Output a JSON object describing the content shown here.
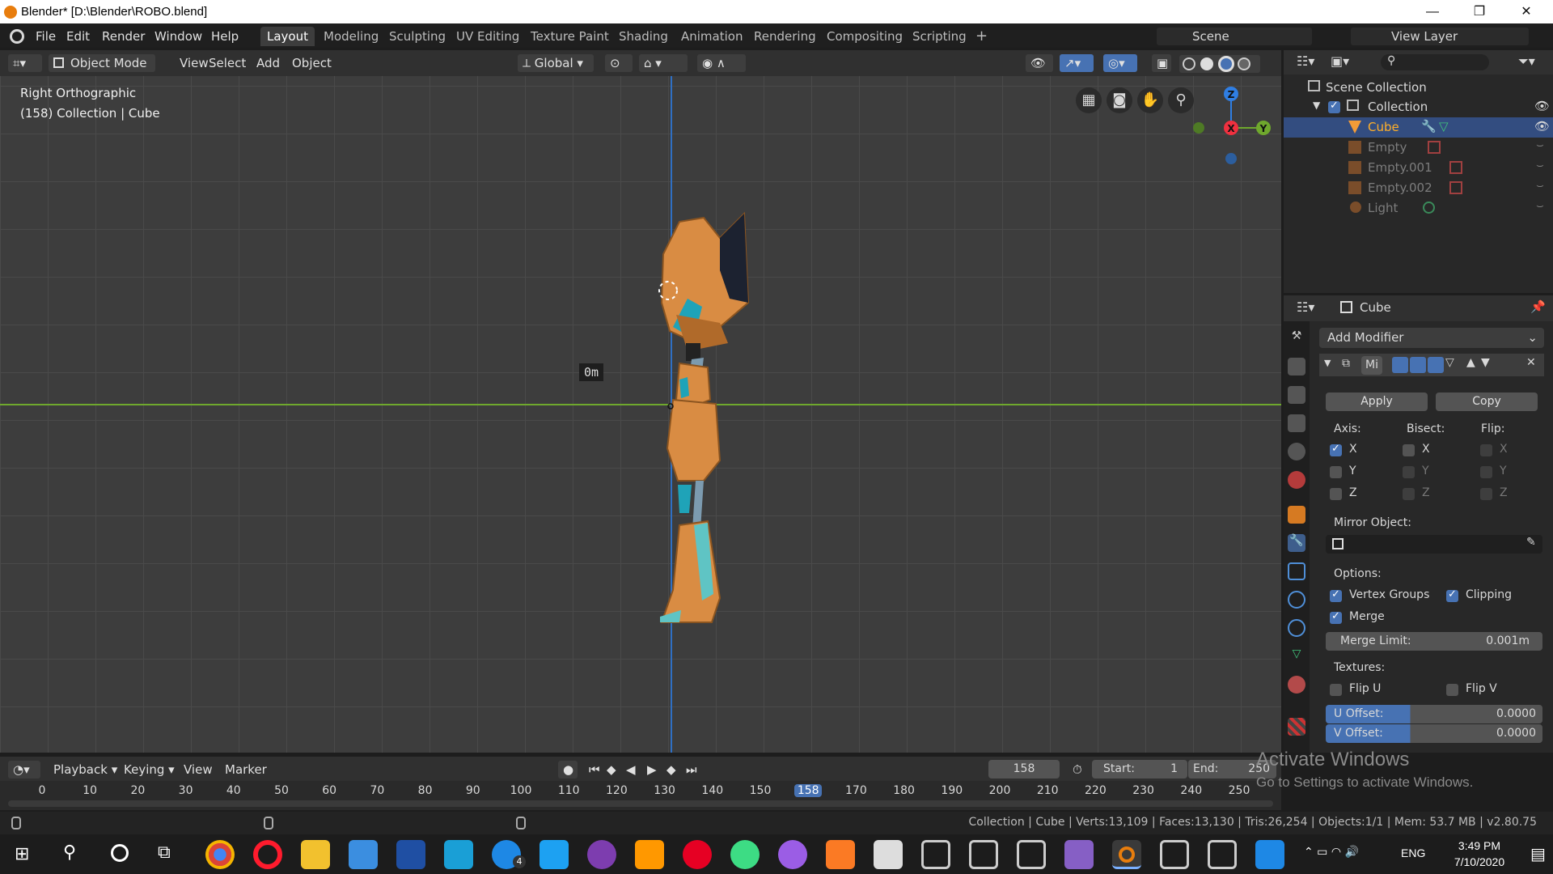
{
  "window": {
    "title": "Blender* [D:\\Blender\\ROBO.blend]"
  },
  "menu": {
    "items": [
      "File",
      "Edit",
      "Render",
      "Window",
      "Help"
    ]
  },
  "workspaces": [
    "Layout",
    "Modeling",
    "Sculpting",
    "UV Editing",
    "Texture Paint",
    "Shading",
    "Animation",
    "Rendering",
    "Compositing",
    "Scripting"
  ],
  "active_workspace": "Layout",
  "scene": {
    "label": "Scene",
    "view_layer": "View Layer"
  },
  "viewport": {
    "mode": "Object Mode",
    "menus": [
      "View",
      "Select",
      "Add",
      "Object"
    ],
    "transform_orientation": "Global",
    "view_name": "Right Orthographic",
    "collection_info": "(158) Collection | Cube",
    "ruler": "0m",
    "gizmo": {
      "z": "Z",
      "x": "X",
      "y": "Y"
    }
  },
  "outliner": {
    "root": "Scene Collection",
    "collection": "Collection",
    "items": [
      "Cube",
      "Empty",
      "Empty.001",
      "Empty.002",
      "Light"
    ]
  },
  "properties": {
    "object": "Cube",
    "add_modifier": "Add Modifier",
    "modifier_name": "Mi",
    "apply": "Apply",
    "copy": "Copy",
    "axis_label": "Axis:",
    "bisect_label": "Bisect:",
    "flip_label": "Flip:",
    "axes": [
      "X",
      "Y",
      "Z"
    ],
    "mirror_object_label": "Mirror Object:",
    "options_label": "Options:",
    "vertex_groups": "Vertex Groups",
    "clipping": "Clipping",
    "merge": "Merge",
    "merge_limit_label": "Merge Limit:",
    "merge_limit": "0.001m",
    "textures_label": "Textures:",
    "flip_u": "Flip U",
    "flip_v": "Flip V",
    "u_offset_label": "U Offset:",
    "u_offset": "0.0000",
    "v_offset_label": "V Offset:",
    "v_offset": "0.0000"
  },
  "timeline": {
    "menus": [
      "Playback",
      "Keying",
      "View",
      "Marker"
    ],
    "current_frame": "158",
    "start_label": "Start:",
    "start": "1",
    "end_label": "End:",
    "end": "250",
    "ticks": [
      "0",
      "10",
      "20",
      "30",
      "40",
      "50",
      "60",
      "70",
      "80",
      "90",
      "100",
      "110",
      "120",
      "130",
      "140",
      "150",
      "158",
      "170",
      "180",
      "190",
      "200",
      "210",
      "220",
      "230",
      "240",
      "250"
    ]
  },
  "watermark": {
    "line1": "Activate Windows",
    "line2": "Go to Settings to activate Windows."
  },
  "status": "Collection | Cube | Verts:13,109 | Faces:13,130 | Tris:26,254 | Objects:1/1 | Mem: 53.7 MB | v2.80.75",
  "taskbar": {
    "time": "3:49 PM",
    "date": "7/10/2020",
    "lang": "ENG",
    "messenger_badge": "4"
  },
  "colors": {
    "accent": "#4772b3",
    "selected": "#ffaf29",
    "x_axis": "#f0303f",
    "y_axis": "#6fa82d",
    "z_axis": "#2f7ee3",
    "robot": "#d98c43"
  }
}
